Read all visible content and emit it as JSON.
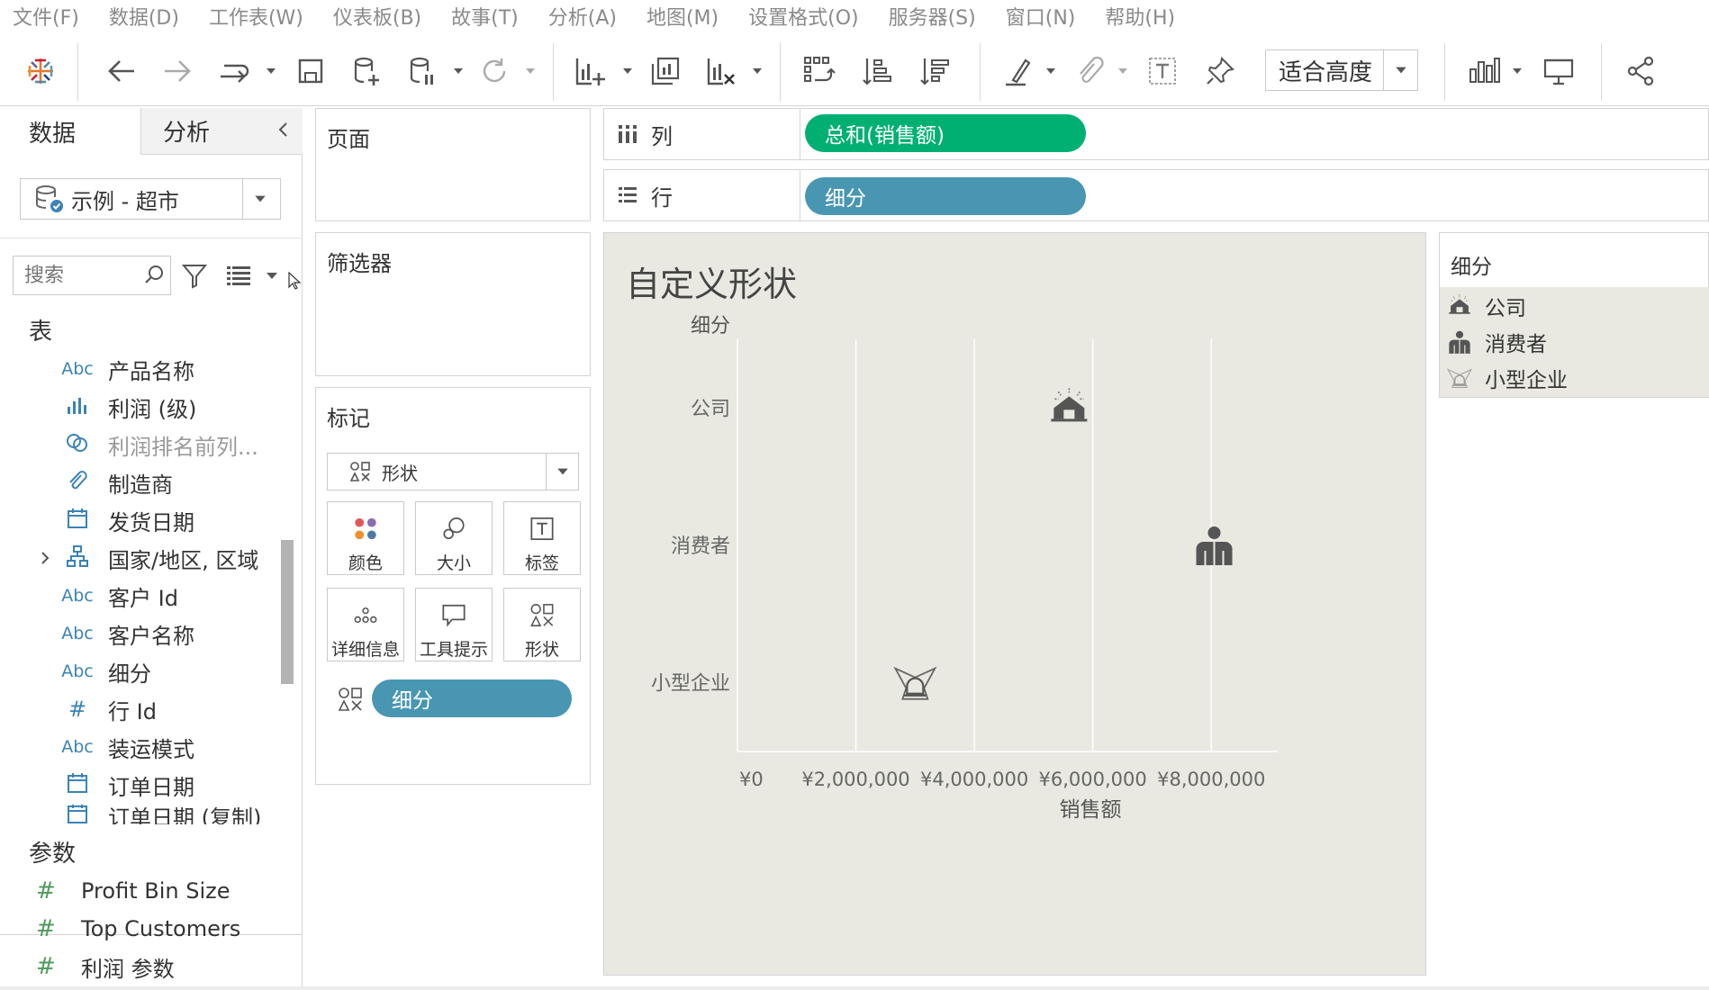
{
  "menu": [
    "文件(F)",
    "数据(D)",
    "工作表(W)",
    "仪表板(B)",
    "故事(T)",
    "分析(A)",
    "地图(M)",
    "设置格式(O)",
    "服务器(S)",
    "窗口(N)",
    "帮助(H)"
  ],
  "toolbar": {
    "fit_label": "适合高度",
    "icons": [
      "tableau-logo-icon",
      "back-icon",
      "forward-icon",
      "redo-icon",
      "save-icon",
      "new-datasource-icon",
      "pause-update-icon",
      "refresh-icon",
      "new-worksheet-icon",
      "duplicate-icon",
      "clear-icon",
      "swap-icon",
      "sort-asc-icon",
      "sort-desc-icon",
      "highlight-icon",
      "group-icon",
      "label-icon",
      "pin-icon",
      "show-me-icon",
      "presentation-icon",
      "share-icon"
    ]
  },
  "left_pane": {
    "tab_data": "数据",
    "tab_analysis": "分析",
    "datasource": "示例 - 超市",
    "search_placeholder": "搜索",
    "tables_title": "表",
    "fields": [
      {
        "type": "Abc",
        "name": "产品名称"
      },
      {
        "type": "measure-icon",
        "name": "利润 (级)"
      },
      {
        "type": "set-icon",
        "name": "利润排名前列..."
      },
      {
        "type": "paperclip-icon",
        "name": "制造商"
      },
      {
        "type": "date-icon",
        "name": "发货日期"
      },
      {
        "type": "hierarchy-icon",
        "name": "国家/地区, 区域"
      },
      {
        "type": "Abc",
        "name": "客户 Id"
      },
      {
        "type": "Abc",
        "name": "客户名称"
      },
      {
        "type": "Abc",
        "name": "细分"
      },
      {
        "type": "#",
        "name": "行 Id"
      },
      {
        "type": "Abc",
        "name": "装运模式"
      },
      {
        "type": "date-icon",
        "name": "订单日期"
      },
      {
        "type": "date-icon",
        "name": "订单日期 (复制)"
      }
    ],
    "params_title": "参数",
    "params": [
      {
        "type": "#",
        "name": "Profit Bin Size"
      },
      {
        "type": "#",
        "name": "Top Customers"
      },
      {
        "type": "#",
        "name": "利润 参数"
      }
    ]
  },
  "cards": {
    "pages": "页面",
    "filters": "筛选器",
    "marks": "标记",
    "mark_type": "形状",
    "mark_buttons": [
      "颜色",
      "大小",
      "标签",
      "详细信息",
      "工具提示",
      "形状"
    ],
    "shape_pill": "细分"
  },
  "shelves": {
    "columns_label": "列",
    "columns_pill": "总和(销售额)",
    "rows_label": "行",
    "rows_pill": "细分"
  },
  "view": {
    "title": "自定义形状",
    "row_header": "细分",
    "x_axis_title": "销售额"
  },
  "chart_data": {
    "type": "scatter",
    "title": "自定义形状",
    "xlabel": "销售额",
    "ylabel": "细分",
    "categories": [
      "公司",
      "消费者",
      "小型企业"
    ],
    "values": [
      5600000,
      8050000,
      3000000
    ],
    "xlim": [
      0,
      9000000
    ],
    "x_ticks": [
      0,
      2000000,
      4000000,
      6000000,
      8000000
    ],
    "x_tick_labels": [
      "¥0",
      "¥2,000,000",
      "¥4,000,000",
      "¥6,000,000",
      "¥8,000,000"
    ],
    "shapes": [
      "corporate-icon",
      "consumer-icon",
      "small-business-icon"
    ],
    "grid": "vertical",
    "background": "#e9e9e1"
  },
  "legend": {
    "title": "细分",
    "items": [
      {
        "label": "公司",
        "icon": "corporate-icon"
      },
      {
        "label": "消费者",
        "icon": "consumer-icon"
      },
      {
        "label": "小型企业",
        "icon": "small-business-icon"
      }
    ]
  },
  "colors": {
    "pill_green": "#00b073",
    "pill_blue": "#4996b2",
    "view_bg": "#e9e9e1"
  }
}
